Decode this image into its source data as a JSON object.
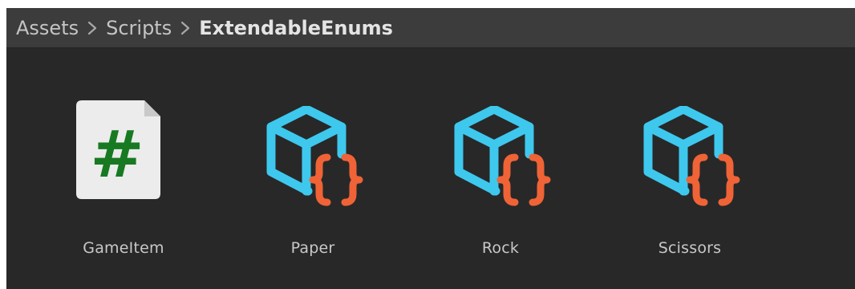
{
  "breadcrumb": {
    "items": [
      "Assets",
      "Scripts",
      "ExtendableEnums"
    ]
  },
  "assets": [
    {
      "label": "GameItem",
      "icon": "csharp-script-icon"
    },
    {
      "label": "Paper",
      "icon": "scriptable-object-icon"
    },
    {
      "label": "Rock",
      "icon": "scriptable-object-icon"
    },
    {
      "label": "Scissors",
      "icon": "scriptable-object-icon"
    }
  ],
  "colors": {
    "panel_background": "#282828",
    "breadcrumb_background": "#3c3c3c",
    "cube_cyan": "#3ec8ee",
    "brace_orange": "#ef6336",
    "script_paper": "#ececec",
    "hash_green": "#177a22"
  },
  "icons": {
    "hash_glyph": "#",
    "brace_glyph": "{}"
  }
}
